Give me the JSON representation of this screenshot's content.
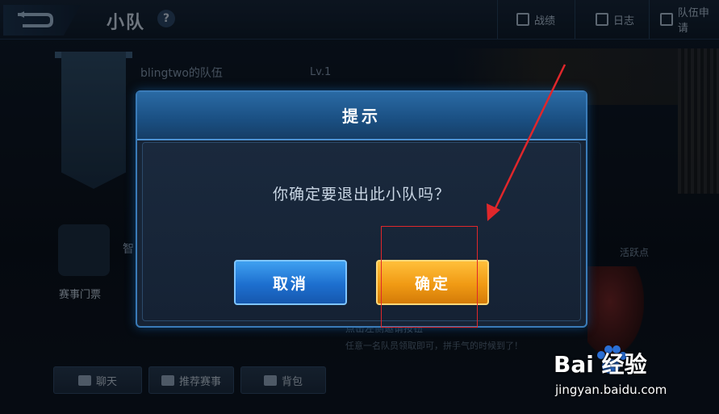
{
  "header": {
    "title": "小队",
    "help": "?"
  },
  "topnav": [
    {
      "label": "战绩"
    },
    {
      "label": "日志"
    },
    {
      "label": "队伍申请"
    }
  ],
  "team": {
    "name": "blingtwo的队伍",
    "level": "Lv.1"
  },
  "left_panel": {
    "ticket_label": "赛事门票",
    "side_label": "智"
  },
  "right_panel": {
    "active_label": "活跃点"
  },
  "hints": {
    "line1": "点击左侧邀请按钮",
    "line2": "任意一名队员领取即可，拼手气的时候到了！"
  },
  "bottom_buttons": [
    {
      "label": "聊天"
    },
    {
      "label": "推荐赛事"
    },
    {
      "label": "背包"
    }
  ],
  "dialog": {
    "title": "提示",
    "message": "你确定要退出此小队吗？",
    "cancel_label": "取消",
    "ok_label": "确定"
  },
  "watermark": {
    "brand": "Bai  经验",
    "url": "jingyan.baidu.com"
  },
  "colors": {
    "cancel": "#1d6fcf",
    "ok": "#f09a14",
    "annotation": "#e0272b"
  }
}
